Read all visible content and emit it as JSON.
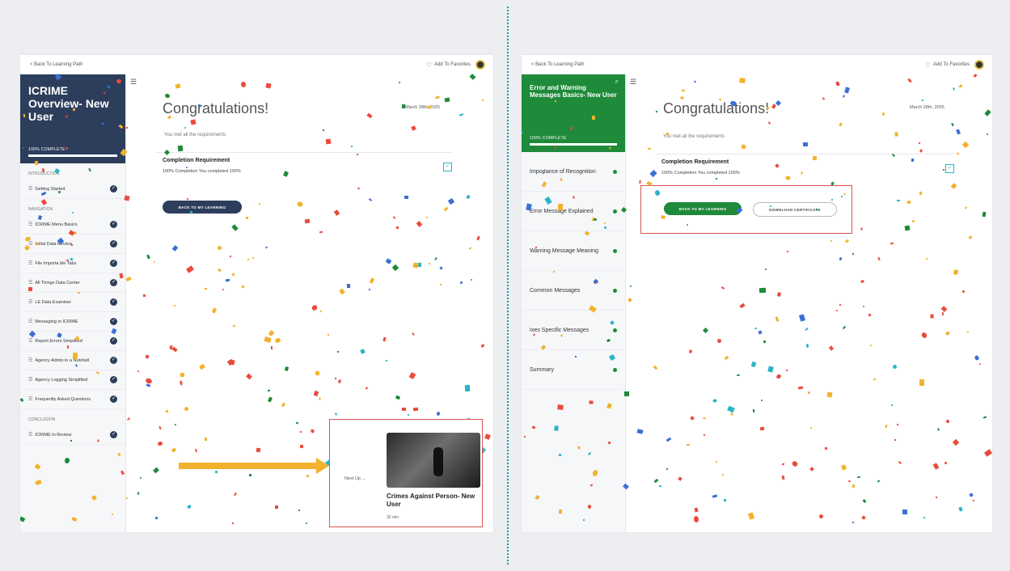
{
  "left_panel": {
    "topbar": {
      "back": "< Back To Learning Path",
      "favorite": "Add To Favorites"
    },
    "sidebar": {
      "title": "ICRIME Overview- New User",
      "progress_label": "100% COMPLETE",
      "sections": [
        {
          "label": "INTRODUCTION",
          "items": [
            {
              "label": "Getting Started"
            }
          ]
        },
        {
          "label": "NAVIGATION",
          "items": [
            {
              "label": "ICRIME Menu Basics"
            },
            {
              "label": "Initial Data Review"
            },
            {
              "label": "File Importa ble Tabs"
            },
            {
              "label": "All Things Data Center"
            },
            {
              "label": "LE Data Examiner"
            },
            {
              "label": "Messaging in ICRIME"
            },
            {
              "label": "Report Errors Simplified"
            },
            {
              "label": "Agency Admin in a Nutshell"
            },
            {
              "label": "Agency Logging Simplified"
            },
            {
              "label": "Frequently Asked Questions"
            }
          ]
        },
        {
          "label": "CONCLUSION",
          "items": [
            {
              "label": "ICRIME In Review"
            }
          ]
        }
      ]
    },
    "main": {
      "title": "Congratulations!",
      "date": "March 28th, 2025",
      "req_met": "You met all the requirements",
      "req_title": "Completion Requirement",
      "req_sub": "100% Completion    You completed 100%",
      "back_button": "BACK TO MY LEARNING"
    },
    "up_next": {
      "label": "Next Up →",
      "title": "Crimes Against Person- New User",
      "time": "35 min"
    }
  },
  "right_panel": {
    "topbar": {
      "back": "< Back To Learning Path",
      "favorite": "Add To Favorites"
    },
    "sidebar": {
      "title": "Error and Warning Messages Basics- New User",
      "progress_label": "100% COMPLETE",
      "items": [
        {
          "label": "Importance of Recognition"
        },
        {
          "label": "Error Message Explained"
        },
        {
          "label": "Warning Message Meaning"
        },
        {
          "label": "Common Messages"
        },
        {
          "label": "Ixes Specific Messages"
        },
        {
          "label": "Summary"
        }
      ]
    },
    "main": {
      "title": "Congratulations!",
      "date": "March 28th, 2025",
      "req_met": "You met all the requirements",
      "req_title": "Completion Requirement",
      "req_sub": "100% Completion    You completed 100%",
      "back_button": "BACK TO MY LEARNING",
      "cert_button": "DOWNLOAD CERTIFICATE"
    }
  },
  "colors": {
    "navy": "#2d3e5c",
    "green": "#1e8a3a",
    "highlight": "#d9534f",
    "arrow": "#f2b22c"
  }
}
